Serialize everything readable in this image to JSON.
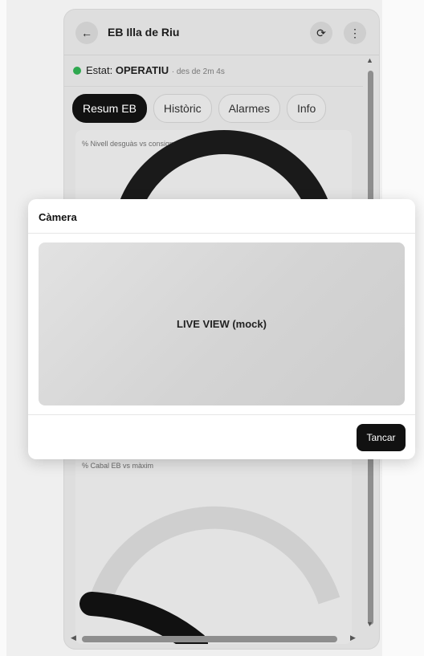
{
  "header": {
    "back_icon": "←",
    "title": "EB Illa de Riu",
    "refresh_icon": "⟳",
    "more_icon": "⋮"
  },
  "status": {
    "prefix": "Estat:",
    "value": "OPERATIU",
    "since": "· des de 2m 4s",
    "color": "#2ea84f"
  },
  "tabs": [
    {
      "label": "Resum EB",
      "active": true
    },
    {
      "label": "Històric",
      "active": false
    },
    {
      "label": "Alarmes",
      "active": false
    },
    {
      "label": "Info",
      "active": false
    }
  ],
  "gauges": {
    "nivell_label": "% Nivell desguàs vs consigna",
    "cabal_label": "% Cabal EB vs màxim"
  },
  "modal": {
    "title": "Càmera",
    "live_view_text": "LIVE VIEW (mock)",
    "close_label": "Tancar"
  }
}
